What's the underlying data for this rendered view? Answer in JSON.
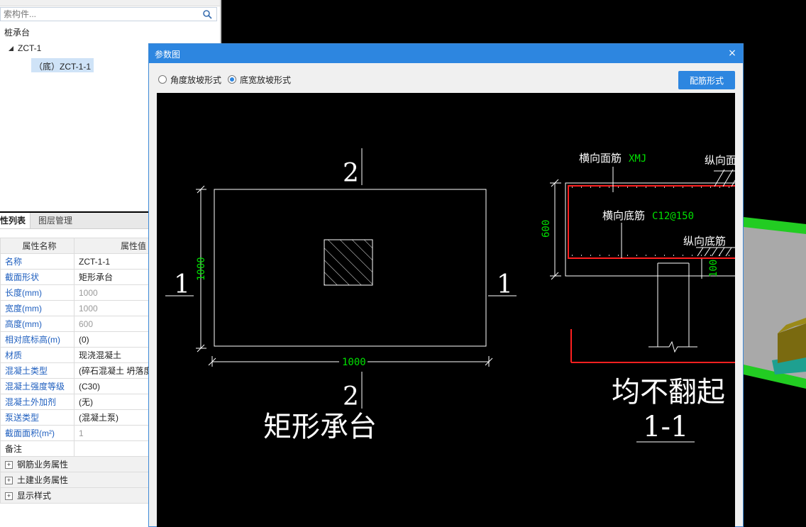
{
  "search": {
    "placeholder": "索构件..."
  },
  "tree": {
    "root": "桩承台",
    "child": "ZCT-1",
    "leaf": "（底）ZCT-1-1"
  },
  "tabs": {
    "properties": "性列表",
    "layers": "图层管理"
  },
  "props": {
    "header_name": "属性名称",
    "header_value": "属性值",
    "rows": [
      {
        "name": "名称",
        "value": "ZCT-1-1"
      },
      {
        "name": "截面形状",
        "value": "矩形承台"
      },
      {
        "name": "长度(mm)",
        "value": "1000"
      },
      {
        "name": "宽度(mm)",
        "value": "1000"
      },
      {
        "name": "高度(mm)",
        "value": "600"
      },
      {
        "name": "相对底标高(m)",
        "value": "(0)"
      },
      {
        "name": "材质",
        "value": "现浇混凝土"
      },
      {
        "name": "混凝土类型",
        "value": "(碎石混凝土 坍落度"
      },
      {
        "name": "混凝土强度等级",
        "value": "(C30)"
      },
      {
        "name": "混凝土外加剂",
        "value": "(无)"
      },
      {
        "name": "泵送类型",
        "value": "(混凝土泵)"
      },
      {
        "name": "截面面积(m²)",
        "value": "1"
      },
      {
        "name": "备注",
        "value": ""
      }
    ],
    "groups": [
      "钢筋业务属性",
      "土建业务属性",
      "显示样式"
    ]
  },
  "dialog": {
    "title": "参数图",
    "close": "×",
    "radio_angle": "角度放坡形式",
    "radio_width": "底宽放坡形式",
    "rebar_button": "配筋形式"
  },
  "drawing": {
    "section_mark_2": "2",
    "section_mark_1": "1",
    "dim_length": "1000",
    "dim_width": "1000",
    "plan_title": "矩形承台",
    "label_top_bar": "横向面筋",
    "label_top_bar_spec": "XMJ",
    "label_long_top": "纵向面",
    "label_bottom_bar": "横向底筋",
    "label_bottom_bar_spec": "C12@150",
    "label_long_bottom": "纵向底筋",
    "dim_height": "600",
    "dim_cover": "100",
    "note_no_bend": "均不翻起",
    "section_title": "1-1"
  },
  "colors": {
    "accent": "#2d86e0",
    "cad_green": "#00e000",
    "cad_red": "#ff2020"
  }
}
